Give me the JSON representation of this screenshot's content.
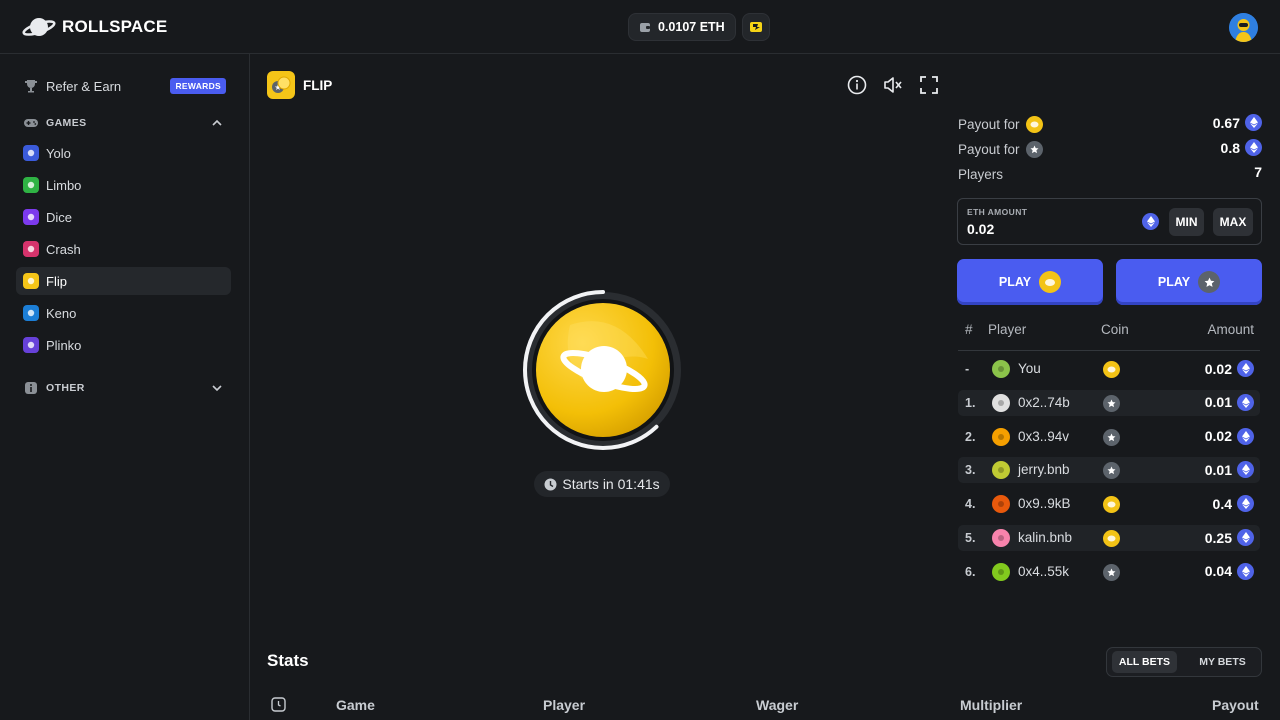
{
  "app": {
    "name": "ROLLSPACE"
  },
  "wallet": {
    "balance": "0.0107 ETH"
  },
  "sidebar": {
    "refer": {
      "label": "Refer & Earn",
      "badge": "REWARDS"
    },
    "games_header": "GAMES",
    "games": [
      {
        "label": "Yolo",
        "color": "#3b5bdb"
      },
      {
        "label": "Limbo",
        "color": "#2fb344"
      },
      {
        "label": "Dice",
        "color": "#7c3aed"
      },
      {
        "label": "Crash",
        "color": "#d6336c"
      },
      {
        "label": "Flip",
        "color": "#f5c518"
      },
      {
        "label": "Keno",
        "color": "#1c7ed6"
      },
      {
        "label": "Plinko",
        "color": "#6741d9"
      }
    ],
    "active_game": "Flip",
    "other_header": "OTHER"
  },
  "game": {
    "title": "FLIP",
    "timer": "Starts in 01:41s",
    "timer_progress": 0.62
  },
  "panel": {
    "payout_label": "Payout for",
    "payout_gold": "0.67",
    "payout_silver": "0.8",
    "players_label": "Players",
    "players_count": "7",
    "amount_label": "ETH AMOUNT",
    "amount_value": "0.02",
    "min_label": "MIN",
    "max_label": "MAX",
    "play_label": "PLAY"
  },
  "players_table": {
    "columns": [
      "#",
      "Player",
      "Coin",
      "Amount"
    ],
    "rows": [
      {
        "rank": "-",
        "name": "You",
        "coin": "gold",
        "amount": "0.02",
        "avatar": "#8bc34a"
      },
      {
        "rank": "1.",
        "name": "0x2..74b",
        "coin": "silver",
        "amount": "0.01",
        "avatar": "#e0e0e0"
      },
      {
        "rank": "2.",
        "name": "0x3..94v",
        "coin": "silver",
        "amount": "0.02",
        "avatar": "#f59f00"
      },
      {
        "rank": "3.",
        "name": "jerry.bnb",
        "coin": "silver",
        "amount": "0.01",
        "avatar": "#c0ca33"
      },
      {
        "rank": "4.",
        "name": "0x9..9kB",
        "coin": "gold",
        "amount": "0.4",
        "avatar": "#e8590c"
      },
      {
        "rank": "5.",
        "name": "kalin.bnb",
        "coin": "gold",
        "amount": "0.25",
        "avatar": "#f783ac"
      },
      {
        "rank": "6.",
        "name": "0x4..55k",
        "coin": "silver",
        "amount": "0.04",
        "avatar": "#82c91e"
      }
    ]
  },
  "stats": {
    "title": "Stats",
    "all_bets": "ALL BETS",
    "my_bets": "MY BETS",
    "columns": [
      "Game",
      "Player",
      "Wager",
      "Multiplier",
      "Payout"
    ]
  },
  "colors": {
    "accent": "#4a5cf0",
    "gold": "#f3c316",
    "silver": "#5c636b",
    "eth": "#4f63e8"
  }
}
